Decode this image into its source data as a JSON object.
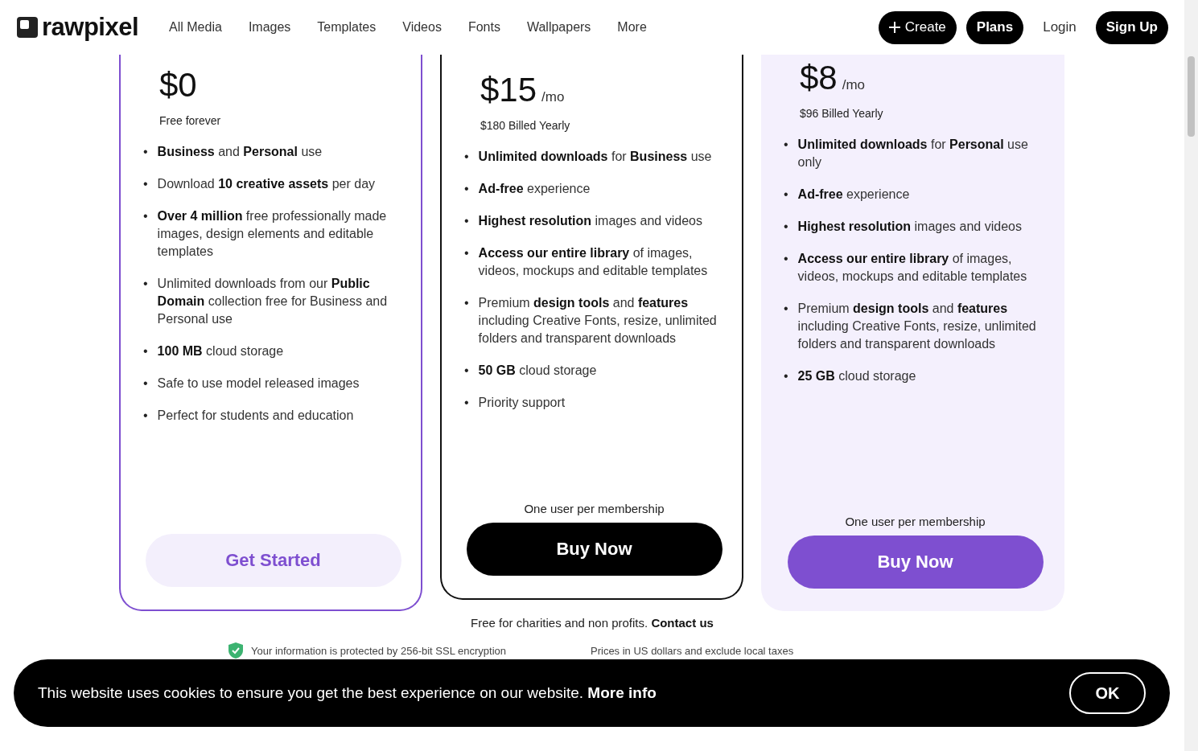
{
  "header": {
    "logo": "rawpixel",
    "nav": [
      "All Media",
      "Images",
      "Templates",
      "Videos",
      "Fonts",
      "Wallpapers",
      "More"
    ],
    "create": "Create",
    "plans": "Plans",
    "login": "Login",
    "signup": "Sign Up"
  },
  "bullet": "•",
  "plans": [
    {
      "kind": "free",
      "price": "$0",
      "billing": "Free forever",
      "features": [
        "**Business** and **Personal** use",
        "Download **10 creative assets** per day",
        "**Over 4 million** free professionally made images, design elements and editable templates",
        "Unlimited downloads from our **Public Domain** collection free for Business and Personal use",
        "**100 MB** cloud storage",
        "Safe to use model released images",
        "Perfect for students and education"
      ],
      "button": "Get Started"
    },
    {
      "kind": "business",
      "price": "$15",
      "period": "/mo",
      "billing": "$180 Billed Yearly",
      "features": [
        "**Unlimited downloads** for **Business** use",
        "**Ad-free** experience",
        "**Highest resolution** images and videos",
        "**Access our entire library** of images, videos, mockups and editable templates",
        "Premium **design tools** and **features** including Creative Fonts, resize, unlimited folders and transparent downloads",
        "**50 GB** cloud storage",
        "Priority support"
      ],
      "note": "One user per membership",
      "button": "Buy Now"
    },
    {
      "kind": "personal",
      "price": "$8",
      "period": "/mo",
      "billing": "$96 Billed Yearly",
      "features": [
        "**Unlimited downloads** for **Personal** use only",
        "**Ad-free** experience",
        "**Highest resolution** images and videos",
        "**Access our entire library** of images, videos, mockups and editable templates",
        "Premium **design tools** and **features** including Creative Fonts, resize, unlimited folders and transparent downloads",
        "**25 GB** cloud storage"
      ],
      "note": "One user per membership",
      "button": "Buy Now"
    }
  ],
  "charities": {
    "text": "Free for charities and non profits.",
    "link": "Contact us"
  },
  "footnotes": [
    "Your information is protected by 256-bit SSL encryption",
    "Prices in US dollars and exclude local taxes"
  ],
  "cookie_banner": {
    "text": "This website uses cookies to ensure you get the best experience on our website.",
    "link": "More info",
    "button": "OK"
  }
}
